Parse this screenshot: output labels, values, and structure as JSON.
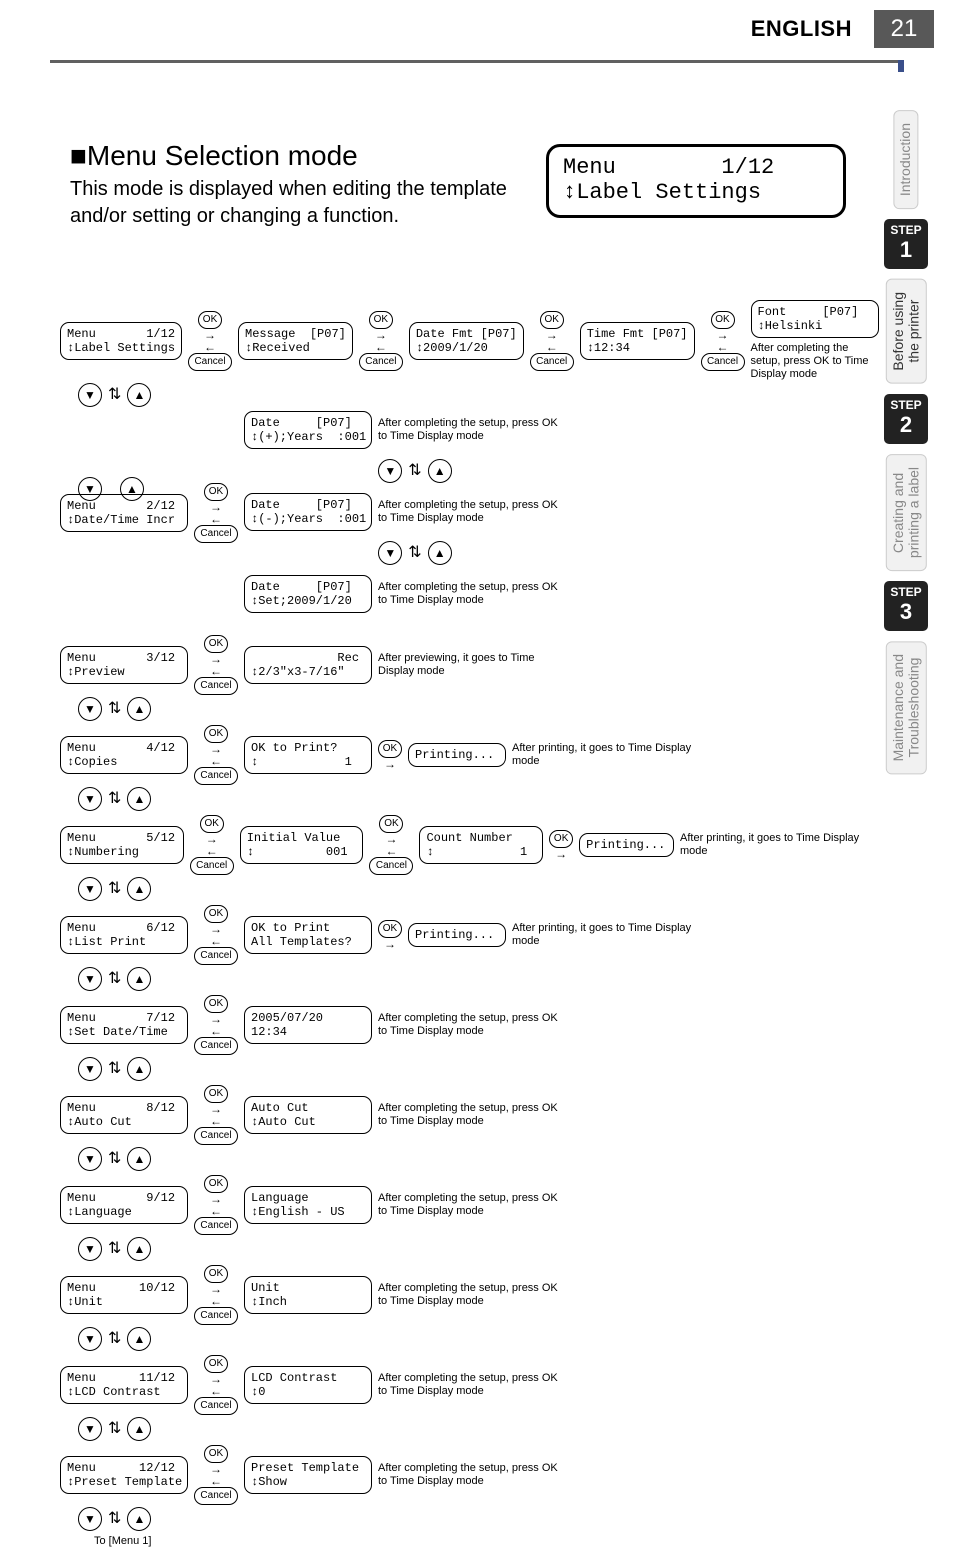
{
  "header": {
    "language": "ENGLISH",
    "page_number": "21"
  },
  "side_tabs": {
    "intro": "Introduction",
    "step1": {
      "label": "STEP",
      "num": "1"
    },
    "before": "Before using\nthe printer",
    "step2": {
      "label": "STEP",
      "num": "2"
    },
    "creating": "Creating and\nprinting a label",
    "step3": {
      "label": "STEP",
      "num": "3"
    },
    "maint": "Maintenance and\nTroubleshooting"
  },
  "section": {
    "title": "■Menu Selection mode",
    "intro": "This mode is displayed when editing the template and/or setting or changing a function."
  },
  "big_lcd": {
    "line1": "Menu        1/12",
    "line2": "↕Label Settings"
  },
  "btn": {
    "ok": "OK",
    "cancel": "Cancel",
    "down": "▼",
    "up": "▲",
    "ud": "⇅"
  },
  "note": {
    "return_time": "After completing the setup, press OK to Time Display mode",
    "font_note": "After completing the setup, press OK to Time Display mode",
    "preview_note": "After previewing, it goes to Time Display mode",
    "print_note": "After printing, it goes to Time Display mode",
    "to_menu1": "To [Menu 1]"
  },
  "lcd": {
    "m1": "Menu       1/12\n↕Label Settings",
    "m1_msg": "Message  [P07]\n↕Received",
    "m1_datefmt": "Date Fmt [P07]\n↕2009/1/20",
    "m1_timefmt": "Time Fmt [P07]\n↕12:34",
    "m1_font": "Font     [P07]\n↕Helsinki",
    "m2": "Menu       2/12\n↕Date/Time Incr",
    "m2_d1": "Date     [P07]\n↕(+);Years  :001",
    "m2_d2": "Date     [P07]\n↕(-);Years  :001",
    "m2_d3": "Date     [P07]\n↕Set;2009/1/20",
    "m3": "Menu       3/12\n↕Preview",
    "m3_rec": "            Rec\n↕2/3\"x3-7/16\"",
    "m4": "Menu       4/12\n↕Copies",
    "m4_ok": "OK to Print?\n↕            1",
    "m4_print": "Printing...",
    "m5": "Menu       5/12\n↕Numbering",
    "m5_init": "Initial Value\n↕          001",
    "m5_count": "Count Number\n↕            1",
    "m5_print": "Printing...",
    "m6": "Menu       6/12\n↕List Print",
    "m6_ok": "OK to Print\nAll Templates?",
    "m6_print": "Printing...",
    "m7": "Menu       7/12\n↕Set Date/Time",
    "m7_set": "2005/07/20\n12:34",
    "m8": "Menu       8/12\n↕Auto Cut",
    "m8_set": "Auto Cut\n↕Auto Cut",
    "m9": "Menu       9/12\n↕Language",
    "m9_set": "Language\n↕English - US",
    "m10": "Menu      10/12\n↕Unit",
    "m10_set": "Unit\n↕Inch",
    "m11": "Menu      11/12\n↕LCD Contrast",
    "m11_set": "LCD Contrast\n↕0",
    "m12": "Menu      12/12\n↕Preset Template",
    "m12_set": "Preset Template\n↕Show"
  }
}
